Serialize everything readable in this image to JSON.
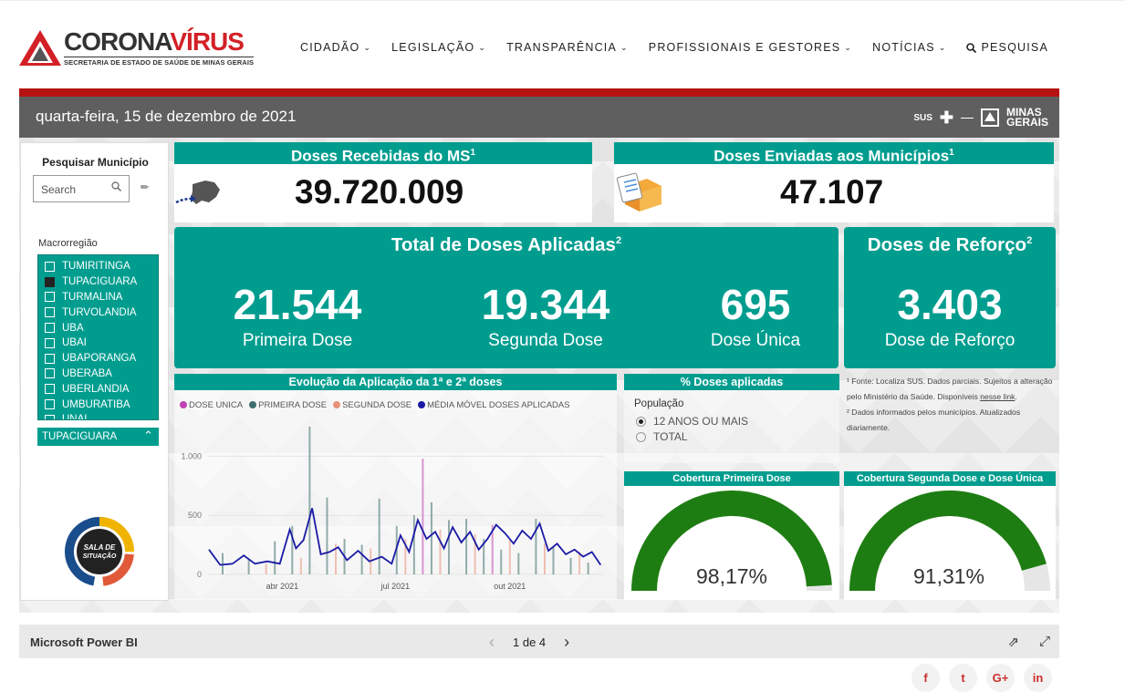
{
  "header": {
    "logo": {
      "title_dark": "CORONA",
      "title_red": "VÍRUS",
      "subtitle": "SECRETARIA DE ESTADO DE SAÚDE DE MINAS GERAIS"
    },
    "nav": [
      "CIDADÃO",
      "LEGISLAÇÃO",
      "TRANSPARÊNCIA",
      "PROFISSIONAIS E GESTORES",
      "NOTÍCIAS"
    ],
    "search_label": "PESQUISA"
  },
  "report": {
    "date": "quarta-feira, 15 de dezembro de 2021",
    "gov": {
      "sus": "SUS",
      "minas": "MINAS",
      "gerais": "GERAIS"
    },
    "slicer": {
      "title": "Pesquisar Município",
      "search_placeholder": "Search",
      "macro_label": "Macrorregião",
      "items": [
        {
          "label": "TUMIRITINGA",
          "checked": false
        },
        {
          "label": "TUPACIGUARA",
          "checked": true
        },
        {
          "label": "TURMALINA",
          "checked": false
        },
        {
          "label": "TURVOLANDIA",
          "checked": false
        },
        {
          "label": "UBA",
          "checked": false
        },
        {
          "label": "UBAI",
          "checked": false
        },
        {
          "label": "UBAPORANGA",
          "checked": false
        },
        {
          "label": "UBERABA",
          "checked": false
        },
        {
          "label": "UBERLANDIA",
          "checked": false
        },
        {
          "label": "UMBURATIBA",
          "checked": false
        },
        {
          "label": "UNAI",
          "checked": false
        }
      ],
      "selected": "TUPACIGUARA",
      "badge_text": [
        "SALA DE",
        "SITUAÇÃO"
      ]
    },
    "doses_recebidas": {
      "title": "Doses Recebidas do MS",
      "sup": "1",
      "value": "39.720.009"
    },
    "doses_enviadas": {
      "title": "Doses Enviadas aos Municípios",
      "sup": "1",
      "value": "47.107"
    },
    "total_aplicadas": {
      "title": "Total de Doses Aplicadas",
      "sup": "2",
      "primeira": {
        "value": "21.544",
        "label": "Primeira Dose"
      },
      "segunda": {
        "value": "19.344",
        "label": "Segunda Dose"
      },
      "unica": {
        "value": "695",
        "label": "Dose Única"
      }
    },
    "reforco": {
      "title": "Doses de Reforço",
      "sup": "2",
      "value": "3.403",
      "label": "Dose de Reforço"
    },
    "evolucao": {
      "title": "Evolução da Aplicação da 1ª e 2ª doses",
      "legend": [
        {
          "name": "DOSE UNICA",
          "color": "#c043b4"
        },
        {
          "name": "PRIMEIRA DOSE",
          "color": "#3d6e6a"
        },
        {
          "name": "SEGUNDA DOSE",
          "color": "#e8917a"
        },
        {
          "name": "MÉDIA MÓVEL DOSES APLICADAS",
          "color": "#1a1aa6"
        }
      ]
    },
    "pct_doses": {
      "title": "% Doses aplicadas",
      "populacao_label": "População",
      "options": [
        {
          "label": "12 ANOS OU MAIS",
          "selected": true
        },
        {
          "label": "TOTAL",
          "selected": false
        }
      ]
    },
    "notes": [
      "¹ Fonte: Localiza SUS. Dados parciais. Sujeitos a alteração pelo Ministério da Saúde. Disponíveis ",
      "nesse link",
      ".",
      "² Dados informados pelos municípios. Atualizados diariamente."
    ],
    "gauge1": {
      "title": "Cobertura Primeira Dose",
      "value_text": "98,17%",
      "value": 0.9817,
      "color": "#1e7d12"
    },
    "gauge2": {
      "title": "Cobertura Segunda Dose e Dose Única",
      "value_text": "91,31%",
      "value": 0.9131,
      "color": "#1e7d12"
    }
  },
  "chart_data": {
    "type": "bar",
    "title": "Evolução da Aplicação da 1ª e 2ª doses",
    "ylim": [
      0,
      1250
    ],
    "yticks": [
      0,
      500,
      1000
    ],
    "ytick_labels": [
      "0",
      "500",
      "1.000"
    ],
    "xtick_labels": [
      "abr 2021",
      "jul 2021",
      "out 2021"
    ],
    "x_start": "2021-02-01",
    "x_end": "2021-12-15",
    "xtick_dates": [
      "2021-04-01",
      "2021-07-01",
      "2021-10-01"
    ],
    "series": [
      {
        "name": "PRIMEIRA DOSE",
        "color": "#3d6e6a",
        "bars": [
          [
            "2021-02-12",
            180
          ],
          [
            "2021-03-05",
            120
          ],
          [
            "2021-03-26",
            280
          ],
          [
            "2021-04-09",
            410
          ],
          [
            "2021-04-23",
            1250
          ],
          [
            "2021-05-07",
            650
          ],
          [
            "2021-05-21",
            300
          ],
          [
            "2021-06-04",
            250
          ],
          [
            "2021-06-18",
            640
          ],
          [
            "2021-07-02",
            410
          ],
          [
            "2021-07-16",
            500
          ],
          [
            "2021-07-30",
            610
          ],
          [
            "2021-08-13",
            460
          ],
          [
            "2021-08-27",
            470
          ],
          [
            "2021-09-10",
            300
          ],
          [
            "2021-09-24",
            210
          ],
          [
            "2021-10-08",
            180
          ],
          [
            "2021-10-22",
            470
          ],
          [
            "2021-11-05",
            230
          ],
          [
            "2021-11-19",
            140
          ],
          [
            "2021-12-03",
            100
          ]
        ]
      },
      {
        "name": "SEGUNDA DOSE",
        "color": "#e8917a",
        "bars": [
          [
            "2021-03-19",
            90
          ],
          [
            "2021-04-16",
            140
          ],
          [
            "2021-05-14",
            260
          ],
          [
            "2021-06-11",
            220
          ],
          [
            "2021-07-09",
            300
          ],
          [
            "2021-08-06",
            380
          ],
          [
            "2021-09-03",
            340
          ],
          [
            "2021-10-01",
            290
          ],
          [
            "2021-10-29",
            260
          ],
          [
            "2021-11-26",
            190
          ]
        ]
      },
      {
        "name": "DOSE UNICA",
        "color": "#c043b4",
        "bars": [
          [
            "2021-07-23",
            980
          ],
          [
            "2021-09-17",
            420
          ]
        ]
      },
      {
        "name": "MÉDIA MÓVEL DOSES APLICADAS",
        "color": "#1a1aa6",
        "points": [
          [
            "2021-02-01",
            210
          ],
          [
            "2021-02-10",
            80
          ],
          [
            "2021-02-20",
            90
          ],
          [
            "2021-03-01",
            160
          ],
          [
            "2021-03-10",
            90
          ],
          [
            "2021-03-20",
            110
          ],
          [
            "2021-03-30",
            90
          ],
          [
            "2021-04-07",
            380
          ],
          [
            "2021-04-12",
            220
          ],
          [
            "2021-04-18",
            290
          ],
          [
            "2021-04-25",
            560
          ],
          [
            "2021-05-02",
            170
          ],
          [
            "2021-05-09",
            190
          ],
          [
            "2021-05-16",
            230
          ],
          [
            "2021-05-23",
            120
          ],
          [
            "2021-06-01",
            200
          ],
          [
            "2021-06-10",
            110
          ],
          [
            "2021-06-20",
            150
          ],
          [
            "2021-06-28",
            90
          ],
          [
            "2021-07-05",
            330
          ],
          [
            "2021-07-12",
            190
          ],
          [
            "2021-07-19",
            460
          ],
          [
            "2021-07-26",
            300
          ],
          [
            "2021-08-02",
            360
          ],
          [
            "2021-08-09",
            220
          ],
          [
            "2021-08-16",
            400
          ],
          [
            "2021-08-23",
            270
          ],
          [
            "2021-08-30",
            360
          ],
          [
            "2021-09-06",
            210
          ],
          [
            "2021-09-13",
            300
          ],
          [
            "2021-09-20",
            420
          ],
          [
            "2021-09-27",
            350
          ],
          [
            "2021-10-04",
            260
          ],
          [
            "2021-10-11",
            370
          ],
          [
            "2021-10-18",
            300
          ],
          [
            "2021-10-25",
            430
          ],
          [
            "2021-11-01",
            200
          ],
          [
            "2021-11-08",
            260
          ],
          [
            "2021-11-15",
            170
          ],
          [
            "2021-11-22",
            210
          ],
          [
            "2021-11-29",
            150
          ],
          [
            "2021-12-06",
            190
          ],
          [
            "2021-12-13",
            80
          ]
        ]
      }
    ]
  },
  "footer": {
    "brand": "Microsoft Power BI",
    "page_text": "1 de 4",
    "social": [
      "f",
      "t",
      "G+",
      "in"
    ]
  }
}
